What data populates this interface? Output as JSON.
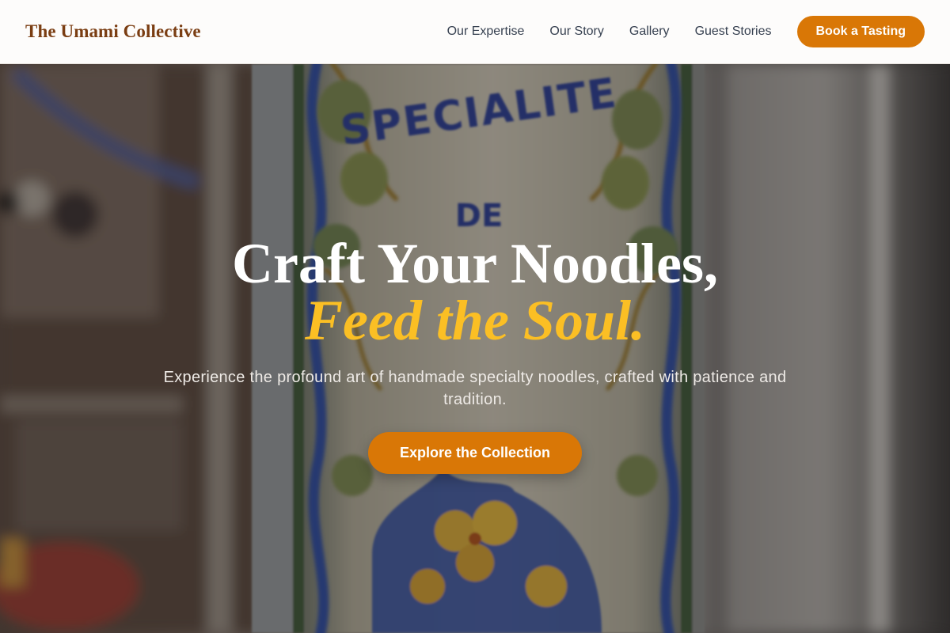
{
  "header": {
    "logo": "The Umami Collective",
    "nav": [
      "Our Expertise",
      "Our Story",
      "Gallery",
      "Guest Stories"
    ],
    "cta_label": "Book a Tasting"
  },
  "hero": {
    "headline_line1": "Craft Your Noodles,",
    "headline_line2": "Feed the Soul.",
    "subtitle": "Experience the profound art of handmade specialty noodles, crafted with patience and tradition.",
    "cta_label": "Explore the Collection",
    "background_sign_text": [
      "SPECIALITE",
      "DE"
    ]
  },
  "colors": {
    "accent": "#d97706",
    "logo": "#7a3d12",
    "headline_accent": "#fbbf24"
  }
}
